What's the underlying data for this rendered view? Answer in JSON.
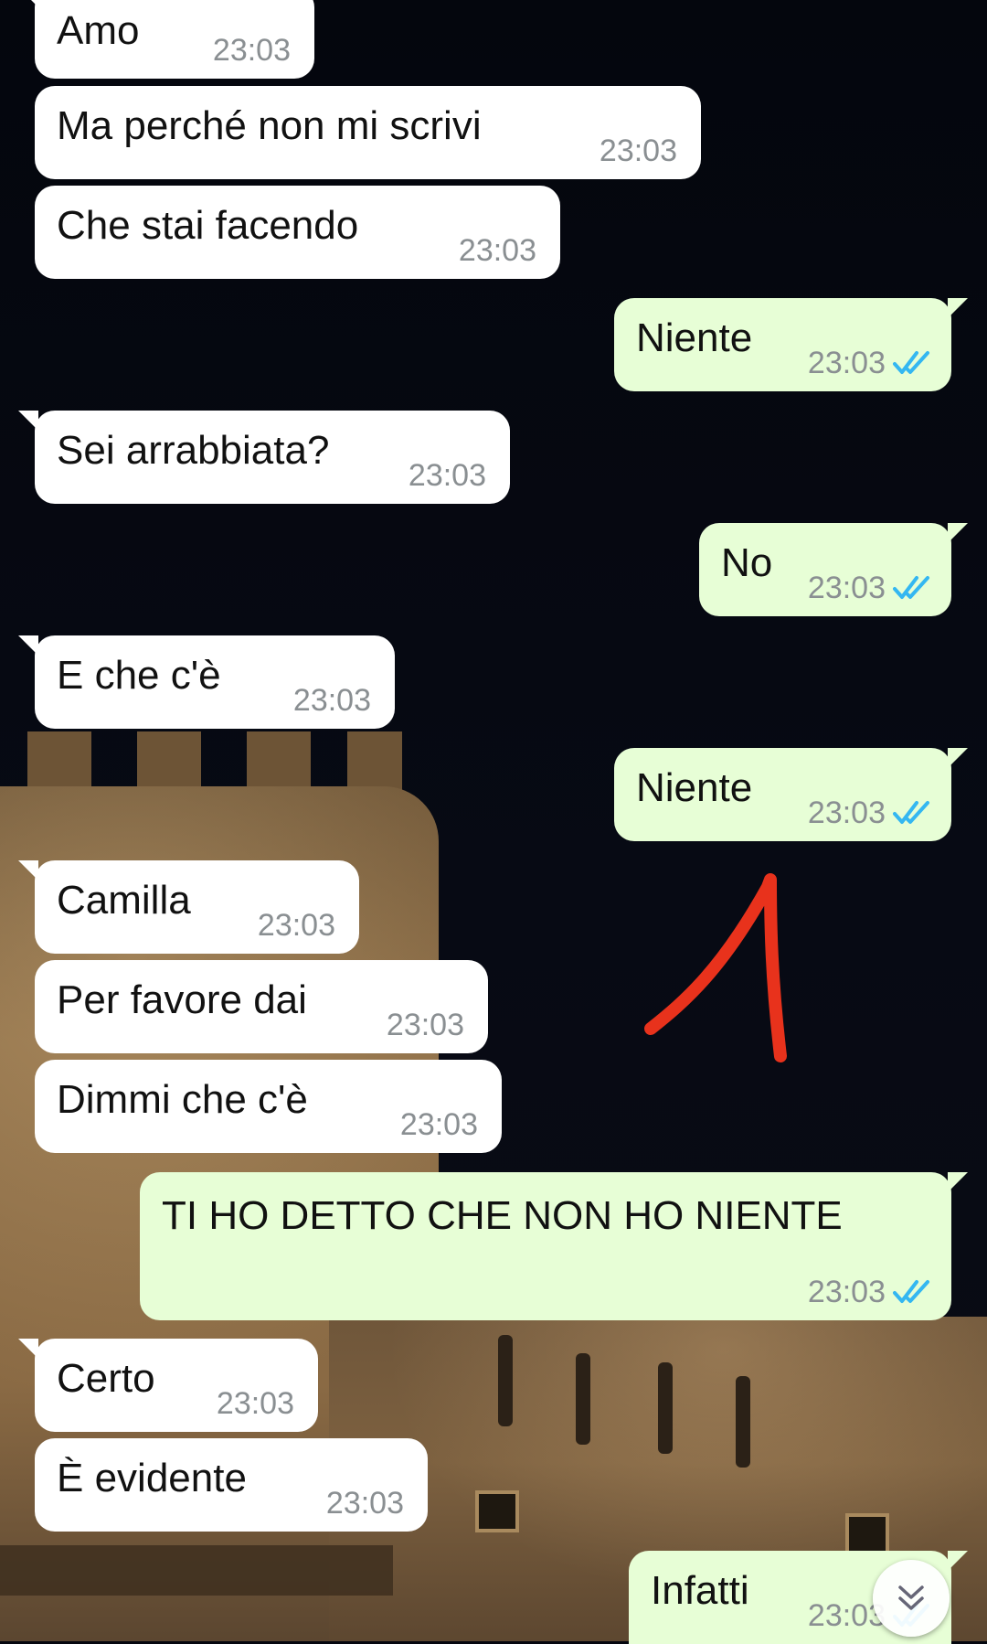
{
  "chat": {
    "messages": [
      {
        "id": "m1",
        "direction": "in",
        "text": "Amo",
        "time": "23:03"
      },
      {
        "id": "m2",
        "direction": "in",
        "text": "Ma perché non mi scrivi",
        "time": "23:03"
      },
      {
        "id": "m3",
        "direction": "in",
        "text": "Che stai facendo",
        "time": "23:03"
      },
      {
        "id": "m4",
        "direction": "out",
        "text": "Niente",
        "time": "23:03",
        "status": "read"
      },
      {
        "id": "m5",
        "direction": "in",
        "text": "Sei arrabbiata?",
        "time": "23:03"
      },
      {
        "id": "m6",
        "direction": "out",
        "text": "No",
        "time": "23:03",
        "status": "read"
      },
      {
        "id": "m7",
        "direction": "in",
        "text": "E che c'è",
        "time": "23:03"
      },
      {
        "id": "m8",
        "direction": "out",
        "text": "Niente",
        "time": "23:03",
        "status": "read"
      },
      {
        "id": "m9",
        "direction": "in",
        "text": "Camilla",
        "time": "23:03"
      },
      {
        "id": "m10",
        "direction": "in",
        "text": "Per favore dai",
        "time": "23:03"
      },
      {
        "id": "m11",
        "direction": "in",
        "text": "Dimmi che c'è",
        "time": "23:03"
      },
      {
        "id": "m12",
        "direction": "out",
        "text": "TI HO DETTO CHE NON HO NIENTE",
        "time": "23:03",
        "status": "read"
      },
      {
        "id": "m13",
        "direction": "in",
        "text": "Certo",
        "time": "23:03"
      },
      {
        "id": "m14",
        "direction": "in",
        "text": "È evidente",
        "time": "23:03"
      },
      {
        "id": "m15",
        "direction": "out",
        "text": "Infatti",
        "time": "23:03",
        "status": "read"
      }
    ]
  },
  "icons": {
    "read_ticks": "double-check-icon",
    "scroll_down": "chevron-double-down-icon",
    "annotation": "red-arrow-annotation"
  },
  "colors": {
    "incoming_bubble": "#ffffff",
    "outgoing_bubble": "#e7fed6",
    "read_ticks": "#34b7f1",
    "timestamp": "#8a8f92",
    "annotation": "#e8321c"
  }
}
